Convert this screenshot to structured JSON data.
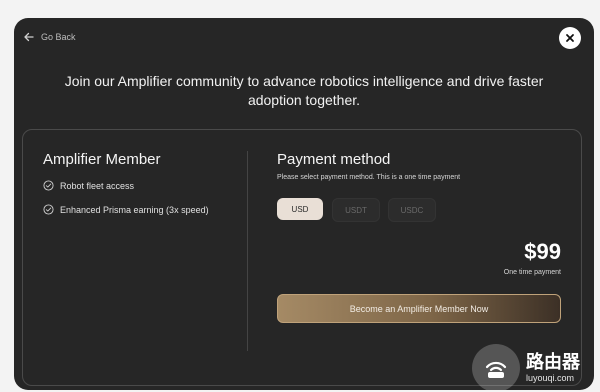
{
  "nav": {
    "back_label": "Go Back"
  },
  "header": {
    "headline": "Join our Amplifier community to advance robotics intelligence and drive faster adoption together."
  },
  "member": {
    "title": "Amplifier Member",
    "benefits": [
      {
        "label": "Robot fleet access",
        "icon": "check-circle-icon"
      },
      {
        "label": "Enhanced Prisma earning (3x speed)",
        "icon": "check-circle-icon"
      }
    ]
  },
  "payment": {
    "title": "Payment method",
    "subtitle": "Please select payment method. This is a one time payment",
    "options": [
      "USD",
      "USDT",
      "USDC"
    ],
    "selected": "USD",
    "price": "$99",
    "price_note": "One time payment",
    "cta_label": "Become an Amplifier Member Now"
  },
  "watermark": {
    "title": "路由器",
    "subtitle": "luyouqi.com"
  },
  "colors": {
    "modal_bg": "#262626",
    "accent": "#a58a65",
    "selected_option_bg": "#e9dfd6"
  }
}
